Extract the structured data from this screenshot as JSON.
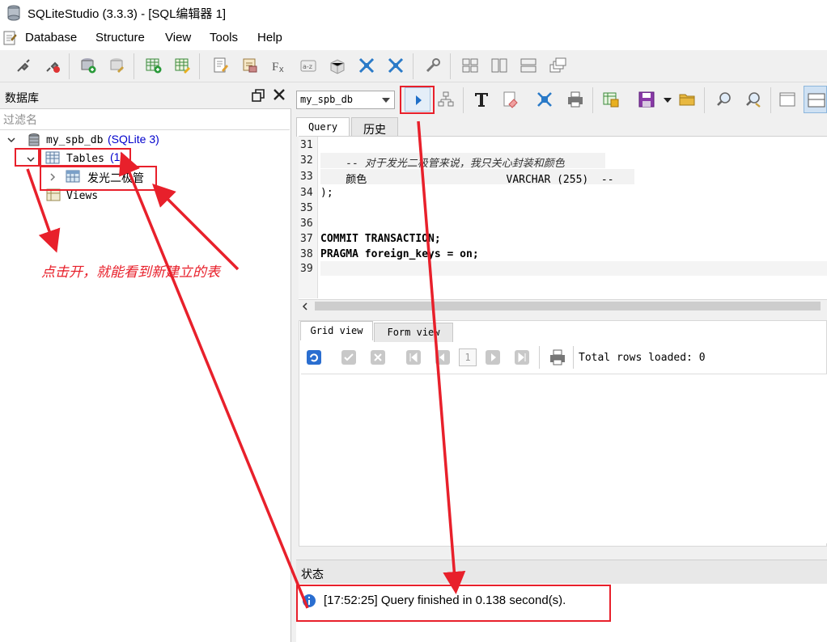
{
  "window": {
    "title": "SQLiteStudio (3.3.3) - [SQL编辑器 1]"
  },
  "menu": {
    "items": [
      "Database",
      "Structure",
      "View",
      "Tools",
      "Help"
    ]
  },
  "db_panel": {
    "title": "数据库",
    "filter_placeholder": "过滤名",
    "database": {
      "name": "my_spb_db",
      "type": "(SQLite 3)"
    },
    "tables": {
      "label": "Tables",
      "count": "(1)"
    },
    "table_item": "发光二极管",
    "views": "Views"
  },
  "editor": {
    "db_selected": "my_spb_db",
    "tabs": [
      "Query",
      "历史"
    ],
    "lines": [
      {
        "n": "31",
        "text": ""
      },
      {
        "n": "32",
        "text": "    -- 对于发光二极管来说，我只关心封装和颜色"
      },
      {
        "n": "33",
        "text": "    颜色                      VARCHAR (255)  --"
      },
      {
        "n": "34",
        "text": ");"
      },
      {
        "n": "35",
        "text": ""
      },
      {
        "n": "36",
        "text": ""
      },
      {
        "n": "37",
        "text": "COMMIT TRANSACTION;"
      },
      {
        "n": "38",
        "text": "PRAGMA foreign_keys = on;"
      },
      {
        "n": "39",
        "text": ""
      }
    ]
  },
  "results": {
    "tabs": [
      "Grid view",
      "Form view"
    ],
    "page": "1",
    "total_rows": "Total rows loaded: 0"
  },
  "status": {
    "title": "状态",
    "message": "[17:52:25]  Query finished in 0.138 second(s)."
  },
  "annotation": {
    "text": "点击开，就能看到新建立的表"
  },
  "colors": {
    "annotation_red": "#e8202b",
    "link_blue": "#0000cc",
    "accent_blue": "#1e6fc8"
  }
}
